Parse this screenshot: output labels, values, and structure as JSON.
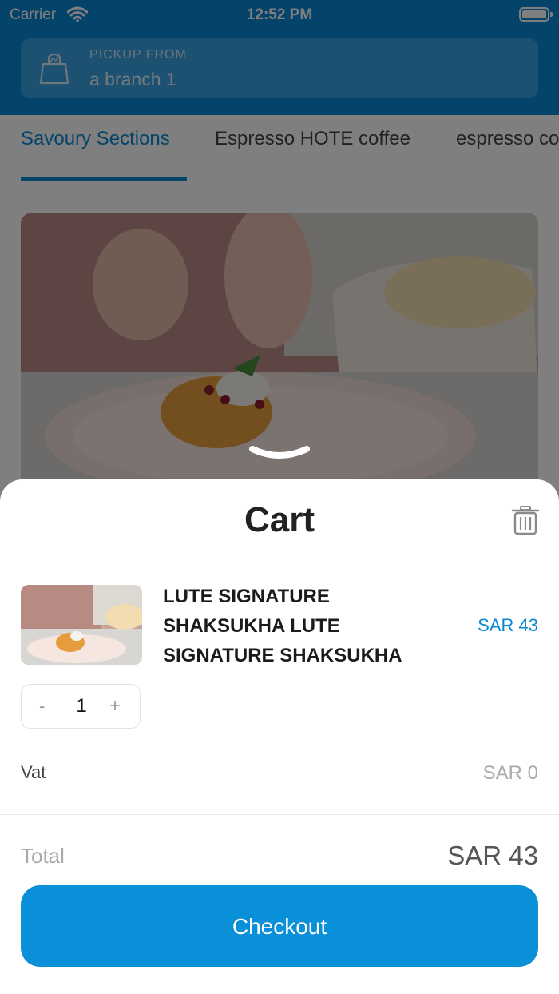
{
  "status_bar": {
    "carrier": "Carrier",
    "time": "12:52 PM"
  },
  "pickup": {
    "label": "PICKUP FROM",
    "value": "a branch 1"
  },
  "tabs": [
    {
      "label": "Savoury Sections",
      "active": true
    },
    {
      "label": "Espresso HOTE coffee",
      "active": false
    },
    {
      "label": "espresso co",
      "active": false
    }
  ],
  "cart": {
    "title": "Cart",
    "item": {
      "name": "LUTE SIGNATURE SHAKSUKHA LUTE SIGNATURE SHAKSUKHA",
      "price": "SAR 43",
      "quantity": "1",
      "minus": "-",
      "plus": "+"
    },
    "vat_label": "Vat",
    "vat_value": "SAR 0",
    "total_label": "Total",
    "total_value": "SAR 43",
    "checkout_label": "Checkout"
  },
  "colors": {
    "accent": "#0a88d4",
    "button": "#0a8fd9"
  },
  "icons": [
    "wifi-icon",
    "battery-icon",
    "shopping-bag-icon",
    "chevron-down-icon",
    "trash-icon"
  ]
}
